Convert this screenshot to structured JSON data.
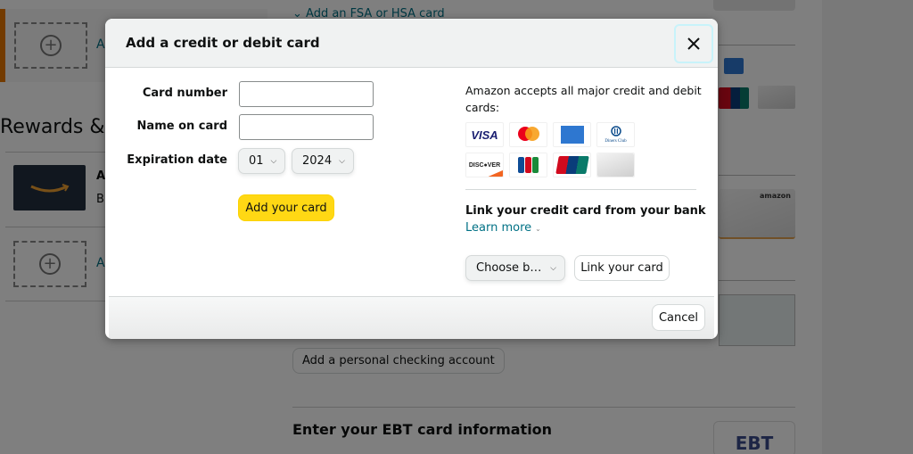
{
  "background": {
    "fsa_link": "Add an FSA or HSA card",
    "rewards_heading": "Rewards &",
    "left_link_a1": "A",
    "left_link_a2": "A",
    "gift_title_initial": "A",
    "gift_sub_initial": "B",
    "checking_button": "Add a personal checking account",
    "ebt_heading": "Enter your EBT card information",
    "ebt_logo": "EBT",
    "amazon_card_brand": "amazon"
  },
  "modal": {
    "title": "Add a credit or debit card",
    "close_label": "✕",
    "form": {
      "card_number_label": "Card number",
      "card_number_value": "",
      "name_label": "Name on card",
      "name_value": "",
      "expiration_label": "Expiration date",
      "month_selected": "01",
      "year_selected": "2024",
      "submit_label": "Add your card"
    },
    "info": {
      "accepts_text": "Amazon accepts all major credit and debit cards:",
      "card_brands": [
        "Visa",
        "Mastercard",
        "American Express",
        "Diners Club",
        "Discover",
        "JCB",
        "UnionPay",
        "Amazon Store Card"
      ],
      "visa_text": "VISA",
      "diners_text": "Diners Club",
      "discover_text": "DISC●VER",
      "link_heading": "Link your credit card from your bank",
      "learn_more": "Learn more",
      "bank_select": "Choose b…",
      "link_button": "Link your card"
    },
    "footer": {
      "cancel_label": "Cancel"
    }
  },
  "colors": {
    "primary_button": "#ffd814",
    "link": "#007185",
    "accent_orange": "#e77600"
  }
}
